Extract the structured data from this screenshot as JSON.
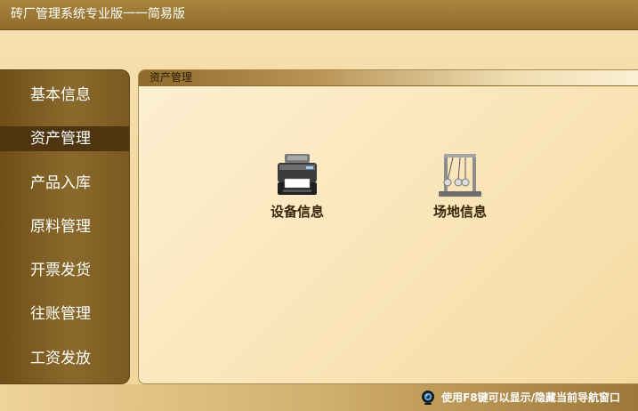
{
  "window": {
    "title": "砖厂管理系统专业版一一简易版"
  },
  "sidebar": {
    "items": [
      {
        "label": "基本信息",
        "active": false
      },
      {
        "label": "资产管理",
        "active": true
      },
      {
        "label": "产品入库",
        "active": false
      },
      {
        "label": "原料管理",
        "active": false
      },
      {
        "label": "开票发货",
        "active": false
      },
      {
        "label": "往账管理",
        "active": false
      },
      {
        "label": "工资发放",
        "active": false
      }
    ]
  },
  "panel": {
    "title": "资产管理",
    "tiles": [
      {
        "label": "设备信息",
        "icon": "printer-icon"
      },
      {
        "label": "场地信息",
        "icon": "newtons-cradle-icon"
      }
    ]
  },
  "status": {
    "tip": "使用F8键可以显示/隐藏当前导航窗口",
    "icon": "webcam-icon"
  },
  "colors": {
    "accent": "#8a6a2c",
    "background": "#f3d9a3",
    "active_nav": "#4f3510"
  }
}
